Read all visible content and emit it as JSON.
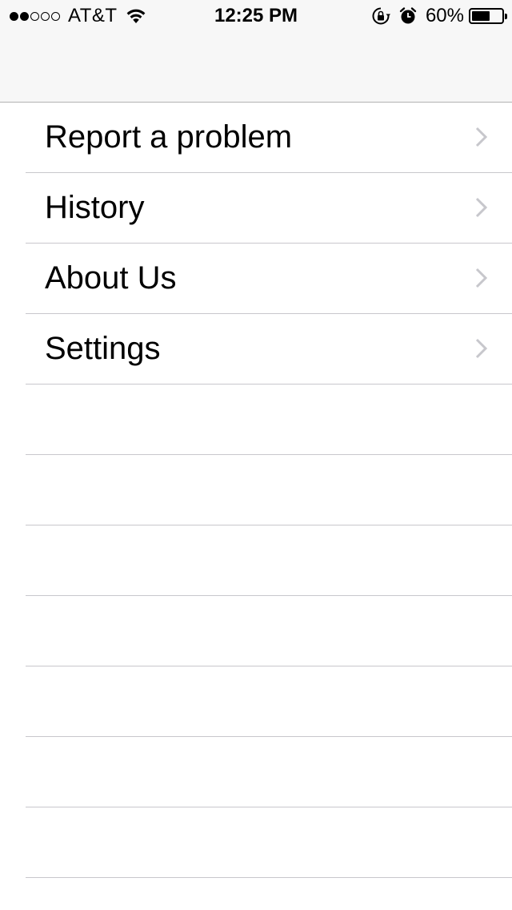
{
  "status_bar": {
    "signal_dots_filled": 2,
    "signal_dots_total": 5,
    "carrier": "AT&T",
    "time": "12:25 PM",
    "battery_percent": "60%",
    "battery_level": 0.6,
    "icons": [
      "wifi-icon",
      "rotation-lock-icon",
      "alarm-icon",
      "battery-icon"
    ]
  },
  "nav": {
    "title": ""
  },
  "menu": {
    "items": [
      {
        "label": "Report a problem",
        "icon": "chevron-right-icon"
      },
      {
        "label": "History",
        "icon": "chevron-right-icon"
      },
      {
        "label": "About Us",
        "icon": "chevron-right-icon"
      },
      {
        "label": "Settings",
        "icon": "chevron-right-icon"
      }
    ],
    "empty_rows": 7
  },
  "colors": {
    "navbar_bg": "#f7f7f7",
    "separator": "#c8c7cc",
    "chevron": "#c7c7cc",
    "text": "#000000"
  }
}
